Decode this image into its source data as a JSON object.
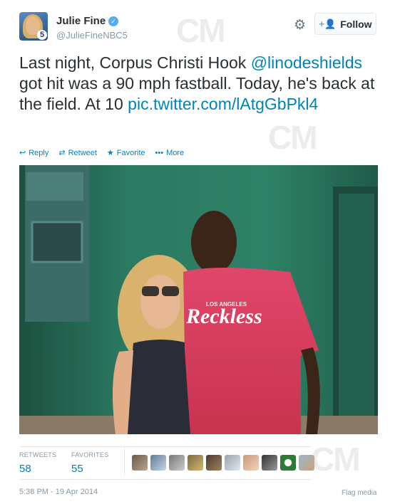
{
  "user": {
    "display_name": "Julie Fine",
    "handle": "@JulieFineNBC5",
    "avatar_badge": "5",
    "verified_icon": "verified-badge-icon"
  },
  "follow_button": {
    "label": "Follow",
    "icon": "add-user-icon"
  },
  "tweet": {
    "text_part1": "Last night, Corpus Christi Hook ",
    "mention": "@linodeshields",
    "text_part2": " got hit was a 90 mph fastball. Today, he's back at the field. At 10 ",
    "pic_link": "pic.twitter.com/lAtgGbPkl4"
  },
  "actions": [
    {
      "label": "Reply",
      "icon": "reply-icon"
    },
    {
      "label": "Retweet",
      "icon": "retweet-icon"
    },
    {
      "label": "Favorite",
      "icon": "star-icon"
    },
    {
      "label": "More",
      "icon": "more-dots-icon"
    }
  ],
  "photo": {
    "shirt_text_small": "LOS ANGELES",
    "shirt_text_large": "Reckless"
  },
  "stats": {
    "retweets_label": "RETWEETS",
    "retweets_count": "58",
    "favorites_label": "FAVORITES",
    "favorites_count": "55"
  },
  "timestamp": "5:38 PM - 19 Apr 2014",
  "flag_media": "Flag media",
  "watermark": "CM",
  "colors": {
    "link": "#0084b4",
    "muted": "#8899a6",
    "text": "#292f33",
    "verified": "#55acee"
  }
}
